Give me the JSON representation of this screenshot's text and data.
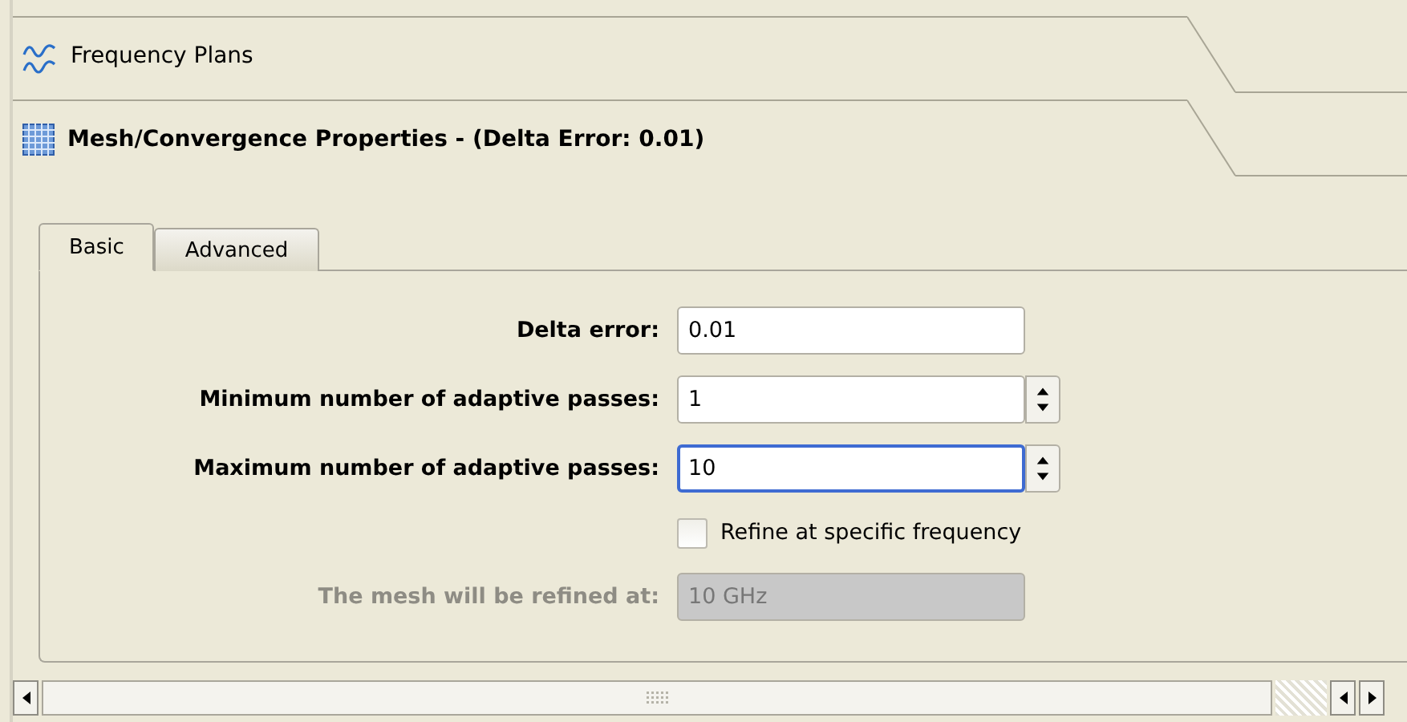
{
  "sections": [
    {
      "title": "Frequency Plans",
      "kind": "wave",
      "expanded": false
    },
    {
      "title": "Mesh/Convergence Properties - (Delta Error: 0.01)",
      "kind": "grid",
      "expanded": true
    }
  ],
  "tabs": [
    {
      "label": "Basic",
      "selected": true
    },
    {
      "label": "Advanced",
      "selected": false
    }
  ],
  "form": [
    {
      "kind": "text",
      "label": "Delta error:",
      "value": "0.01",
      "disabled": false,
      "focused": false
    },
    {
      "kind": "spinner",
      "label": "Minimum number of adaptive passes:",
      "value": "1",
      "disabled": false,
      "focused": false
    },
    {
      "kind": "spinner",
      "label": "Maximum number of adaptive passes:",
      "value": "10",
      "disabled": false,
      "focused": true
    },
    {
      "kind": "checkbox",
      "label": "Refine at specific frequency",
      "checked": false,
      "disabled": false
    },
    {
      "kind": "text",
      "label": "The mesh will be refined at:",
      "value": "10 GHz",
      "disabled": true,
      "focused": false
    }
  ]
}
